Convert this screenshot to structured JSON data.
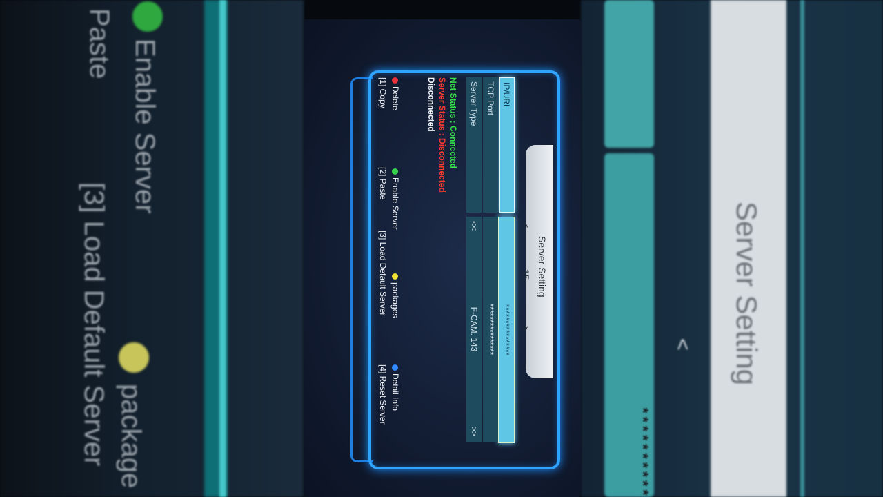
{
  "dialog": {
    "title": "Server Setting",
    "nav_prev": "<",
    "server_number": "15",
    "nav_next": ">",
    "fields": [
      {
        "label": "IP/URL",
        "value": "****************",
        "selected": true
      },
      {
        "label": "TCP Port",
        "value": "****************",
        "selected": false
      },
      {
        "label": "Server Type",
        "value": "F-CAM. 143",
        "arrow_left": "<<",
        "arrow_right": ">>",
        "selected": false
      }
    ],
    "status": {
      "net": "Net Status : Connected",
      "server": "Server Status : Disconnected",
      "detail": "Disconnected"
    },
    "buttons": {
      "delete": "Delete",
      "enable_server": "Enable Server",
      "packages": "packages",
      "detail_info": "Detail Info",
      "copy": "[1] Copy",
      "paste": "[2] Paste",
      "load_default": "[3] Load Default Server",
      "reset_server": "[4] Reset Server"
    },
    "colors": {
      "red": "#e8323a",
      "green": "#34d44a",
      "yellow": "#f2e23a",
      "blue": "#2f8bff"
    }
  },
  "background": {
    "enable_server": "Enable Server",
    "paste": "Paste",
    "load_default": "[3] Load Default Server",
    "packages": "package",
    "title": "Server Setting",
    "nav_prev": "<",
    "stars": "**********"
  }
}
